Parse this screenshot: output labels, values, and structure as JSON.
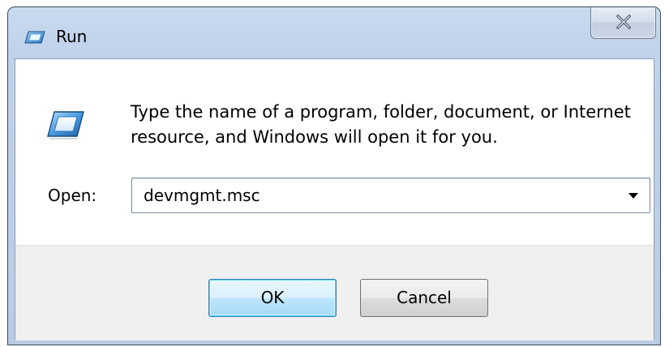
{
  "window": {
    "title": "Run",
    "icon": "run-icon",
    "close_icon": "close-icon"
  },
  "dialog": {
    "description": "Type the name of a program, folder, document, or Internet resource, and Windows will open it for you.",
    "open_label": "Open:",
    "open_value": "devmgmt.msc",
    "dropdown_icon": "chevron-down-icon"
  },
  "buttons": {
    "ok_label": "OK",
    "cancel_label": "Cancel"
  },
  "colors": {
    "title_bar": "#bfd2ea",
    "button_area": "#f0f0f0",
    "default_button_border": "#3c7fb1"
  }
}
